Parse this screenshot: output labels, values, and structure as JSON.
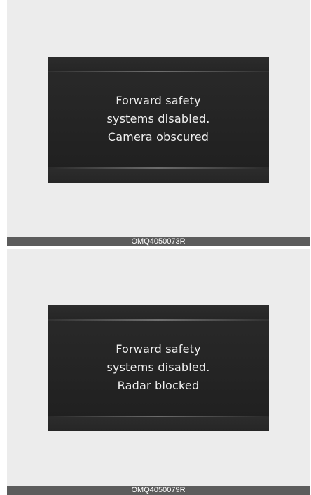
{
  "figures": [
    {
      "message_lines": [
        "Forward safety",
        "systems disabled.",
        "Camera obscured"
      ],
      "code": "OMQ4050073R"
    },
    {
      "message_lines": [
        "Forward safety",
        "systems disabled.",
        "Radar blocked"
      ],
      "code": "OMQ4050079R"
    }
  ],
  "colors": {
    "panel_background": "#ececec",
    "display_background": "#222222",
    "message_text": "#f0f0f0",
    "caption_bar": "#5c5c5c"
  }
}
